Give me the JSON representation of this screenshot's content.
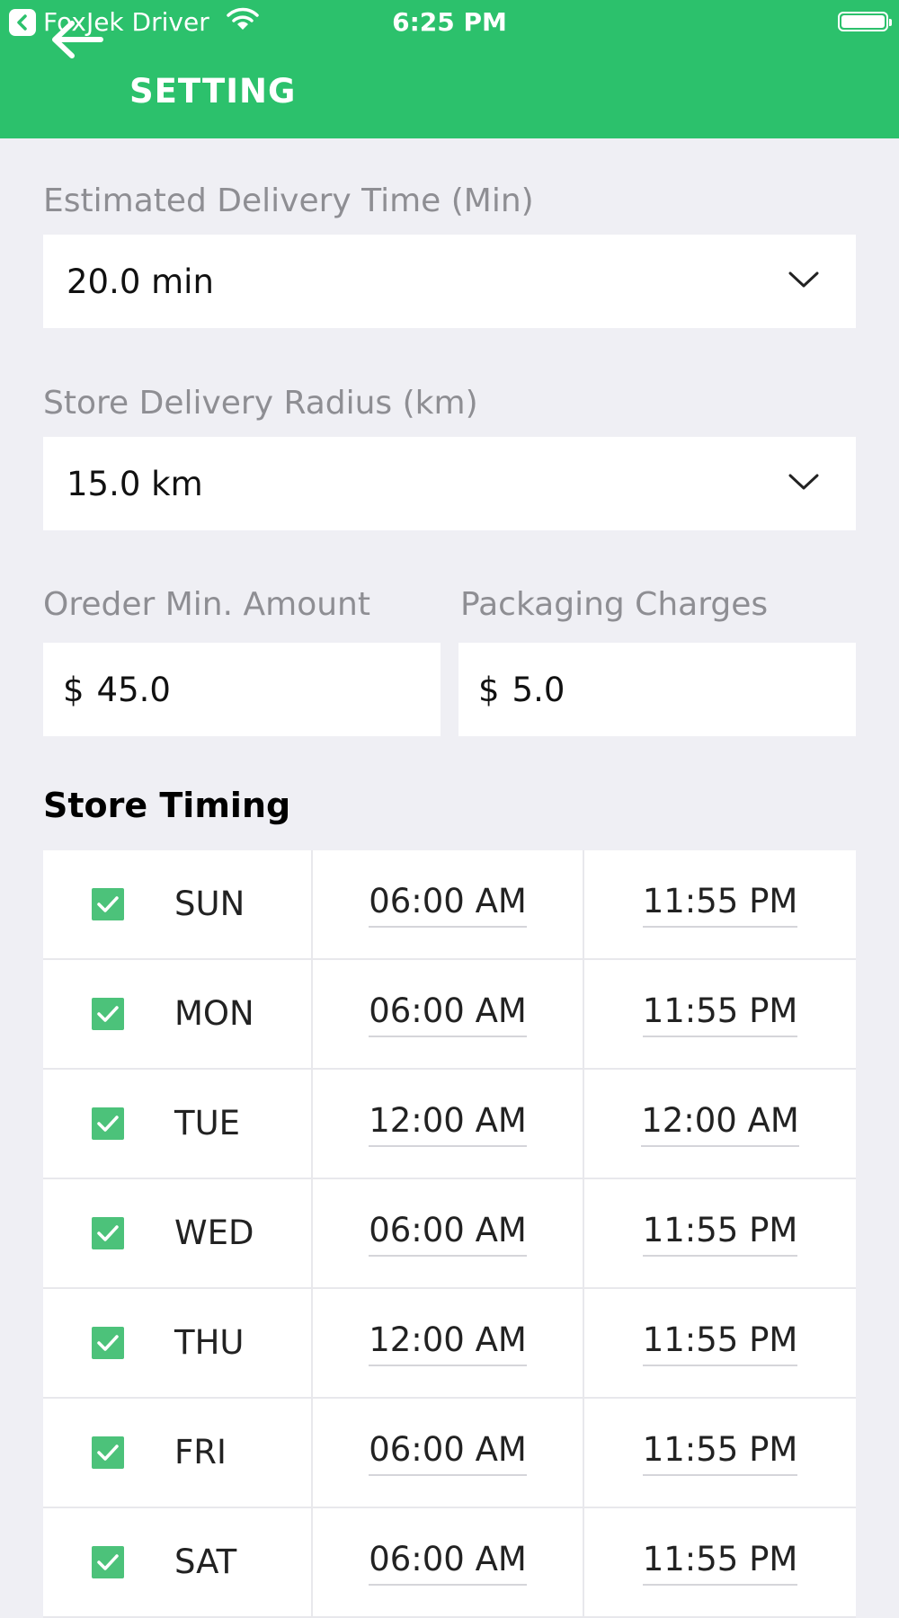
{
  "status_bar": {
    "back_app": "FoxJek Driver",
    "time": "6:25 PM"
  },
  "header": {
    "title": "SETTING"
  },
  "delivery_time": {
    "label": "Estimated Delivery Time (Min)",
    "value": "20.0 min"
  },
  "delivery_radius": {
    "label": "Store Delivery Radius (km)",
    "value": "15.0 km"
  },
  "min_amount": {
    "label": "Oreder Min. Amount",
    "currency": "$",
    "value": "45.0"
  },
  "packaging": {
    "label": "Packaging Charges",
    "currency": "$",
    "value": "5.0"
  },
  "store_timing": {
    "title": "Store Timing",
    "rows": [
      {
        "day": "SUN",
        "open": "06:00 AM",
        "close": "11:55 PM"
      },
      {
        "day": "MON",
        "open": "06:00 AM",
        "close": "11:55 PM"
      },
      {
        "day": "TUE",
        "open": "12:00 AM",
        "close": "12:00 AM"
      },
      {
        "day": "WED",
        "open": "06:00 AM",
        "close": "11:55 PM"
      },
      {
        "day": "THU",
        "open": "12:00 AM",
        "close": "11:55 PM"
      },
      {
        "day": "FRI",
        "open": "06:00 AM",
        "close": "11:55 PM"
      },
      {
        "day": "SAT",
        "open": "06:00 AM",
        "close": "11:55 PM"
      }
    ]
  },
  "colors": {
    "brand": "#2cc16c",
    "checkbox": "#4cc27a"
  }
}
